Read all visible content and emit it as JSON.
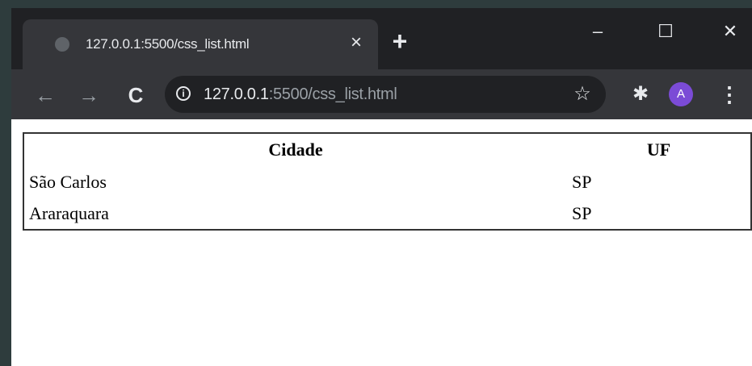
{
  "browser": {
    "tab": {
      "title": "127.0.0.1:5500/css_list.html",
      "close_glyph": "×",
      "favicon": "globe-icon"
    },
    "new_tab_glyph": "+",
    "window_controls": {
      "minimize": "–",
      "maximize": "☐",
      "close": "✕"
    },
    "toolbar": {
      "back": "←",
      "forward": "→",
      "reload": "C",
      "url_host": "127.0.0.1",
      "url_rest": ":5500/css_list.html",
      "info_glyph": "i",
      "star_glyph": "☆",
      "extensions_glyph": "✱",
      "avatar_letter": "A",
      "avatar_color": "#7b4bd6",
      "menu_glyph": "⋮"
    }
  },
  "table": {
    "headers": [
      "Cidade",
      "UF"
    ],
    "rows": [
      [
        "São Carlos",
        "SP"
      ],
      [
        "Araraquara",
        "SP"
      ]
    ]
  }
}
